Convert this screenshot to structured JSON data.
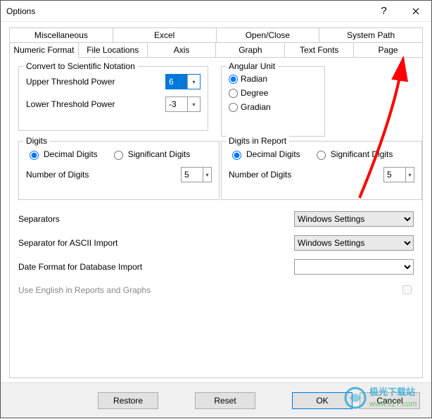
{
  "window": {
    "title": "Options"
  },
  "tabs_row1": [
    "Miscellaneous",
    "Excel",
    "Open/Close",
    "System Path"
  ],
  "tabs_row2": [
    "Numeric Format",
    "File Locations",
    "Axis",
    "Graph",
    "Text Fonts",
    "Page"
  ],
  "active_tab": "Numeric Format",
  "sci": {
    "legend": "Convert to Scientific Notation",
    "upper_lbl": "Upper Threshold Power",
    "upper_val": "6",
    "lower_lbl": "Lower Threshold Power",
    "lower_val": "-3"
  },
  "ang": {
    "legend": "Angular Unit",
    "radian": "Radian",
    "degree": "Degree",
    "gradian": "Gradian",
    "selected": "Radian"
  },
  "digits": {
    "legend": "Digits",
    "decimal": "Decimal Digits",
    "significant": "Significant Digits",
    "selected": "Decimal Digits",
    "num_lbl": "Number of Digits",
    "num_val": "5"
  },
  "digitsR": {
    "legend": "Digits in Report",
    "decimal": "Decimal Digits",
    "significant": "Significant Digits",
    "selected": "Decimal Digits",
    "num_lbl": "Number of Digits",
    "num_val": "5"
  },
  "separators": {
    "lbl": "Separators",
    "val": "Windows Settings"
  },
  "ascii": {
    "lbl": "Separator for ASCII Import",
    "val": "Windows Settings"
  },
  "dateformat": {
    "lbl": "Date Format for Database Import",
    "val": ""
  },
  "english": {
    "lbl": "Use English in Reports and Graphs",
    "checked": false
  },
  "buttons": {
    "restore": "Restore",
    "reset": "Reset",
    "ok": "OK",
    "cancel": "Cancel"
  },
  "watermark": {
    "text1": "极光下载站",
    "text2": "www.xz7.com"
  }
}
